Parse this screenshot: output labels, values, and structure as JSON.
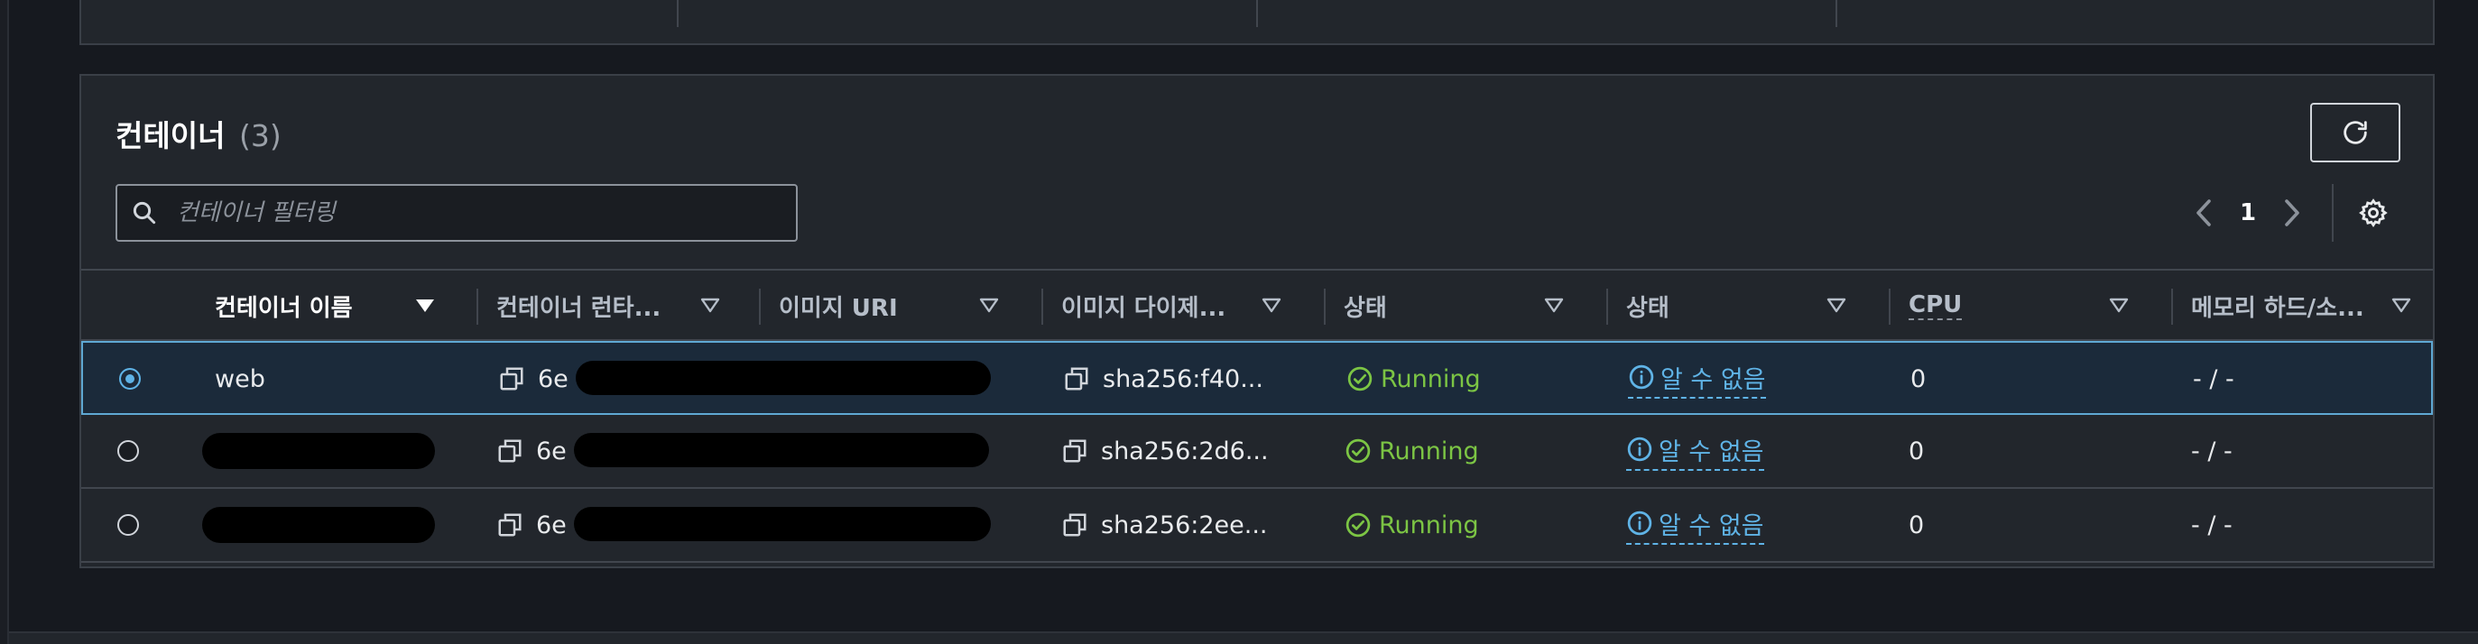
{
  "panel": {
    "title": "컨테이너",
    "count": "(3)"
  },
  "search": {
    "placeholder": "컨테이너 필터링",
    "value": ""
  },
  "pagination": {
    "current_page": "1"
  },
  "table": {
    "columns": [
      {
        "label": "컨테이너 이름",
        "sorted": true
      },
      {
        "label": "컨테이너 런타...",
        "sorted": false
      },
      {
        "label": "이미지 URI",
        "sorted": false
      },
      {
        "label": "이미지 다이제...",
        "sorted": false
      },
      {
        "label": "상태",
        "sorted": false
      },
      {
        "label": "상태",
        "sorted": false
      },
      {
        "label": "CPU",
        "sorted": false
      },
      {
        "label": "메모리 하드/소...",
        "sorted": false
      }
    ],
    "rows": [
      {
        "selected": true,
        "name": "web",
        "runtime_id": "6e",
        "image_uri": "",
        "digest": "sha256:f40...",
        "status": "Running",
        "health": "알 수 없음",
        "cpu": "0",
        "memory": "- / -"
      },
      {
        "selected": false,
        "name": "",
        "runtime_id": "6e",
        "image_uri": "",
        "digest": "sha256:2d6...",
        "status": "Running",
        "health": "알 수 없음",
        "cpu": "0",
        "memory": "- / -"
      },
      {
        "selected": false,
        "name": "",
        "runtime_id": "6e",
        "image_uri": "",
        "digest": "sha256:2ee...",
        "status": "Running",
        "health": "알 수 없음",
        "cpu": "0",
        "memory": "- / -"
      }
    ]
  },
  "colors": {
    "background": "#16191f",
    "panel": "#22262c",
    "accent": "#5fb3e6",
    "success": "#7cc544"
  },
  "icons": {
    "search": "search-icon",
    "refresh": "refresh-icon",
    "prev": "chevron-left-icon",
    "next": "chevron-right-icon",
    "settings": "gear-icon",
    "copy": "copy-icon",
    "running": "check-circle-icon",
    "unknown": "info-circle-icon"
  }
}
